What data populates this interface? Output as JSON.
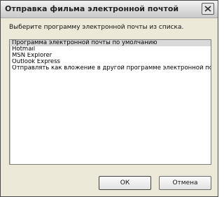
{
  "window": {
    "title": "Отправка фильма электронной почтой"
  },
  "dialog": {
    "prompt": "Выберите программу электронной почты из списка.",
    "selected_index": 0,
    "items": [
      "Программа электронной почты по умолчанию",
      "Hotmail",
      "MSN Explorer",
      "Outlook Express",
      "Отправлять как вложение в другой программе электронной по"
    ],
    "ok_label": "ОК",
    "cancel_label": "Отмена"
  },
  "icons": {
    "close": "close-icon"
  }
}
